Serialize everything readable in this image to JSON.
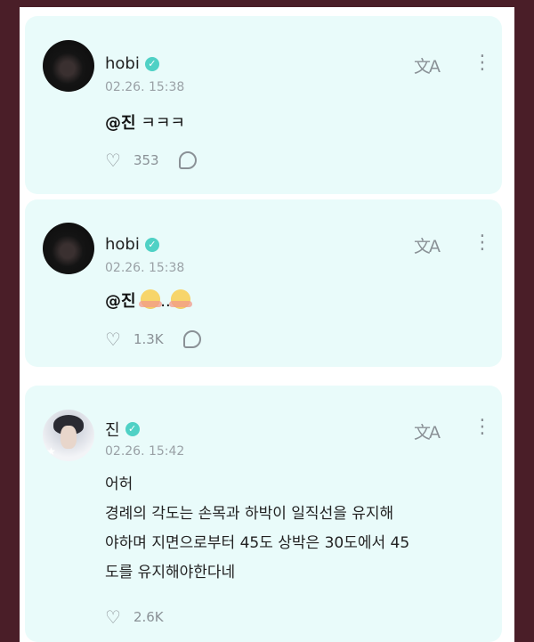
{
  "posts": [
    {
      "author": "hobi",
      "time": "02.26. 15:38",
      "mention": "@진",
      "message": " ㅋㅋㅋ",
      "reactions": "353"
    },
    {
      "author": "hobi",
      "time": "02.26. 15:38",
      "mention": "@진",
      "message": "..",
      "reactions": "1.3K"
    },
    {
      "author": "진",
      "time": "02.26. 15:42",
      "lines": [
        "어허",
        "경례의 각도는 손목과 하박이 일직선을 유지해",
        "야하며 지면으로부터 45도 상박은 30도에서 45",
        "도를 유지해야한다네"
      ],
      "reactions": "2.6K"
    }
  ],
  "icons": {
    "translate": "文A",
    "more": "⋮",
    "verified": "✓",
    "react": "♡"
  },
  "colors": {
    "card_bg": "#e9fbfa",
    "verified": "#4fd1c5",
    "outer_bg": "#4a1e28"
  }
}
